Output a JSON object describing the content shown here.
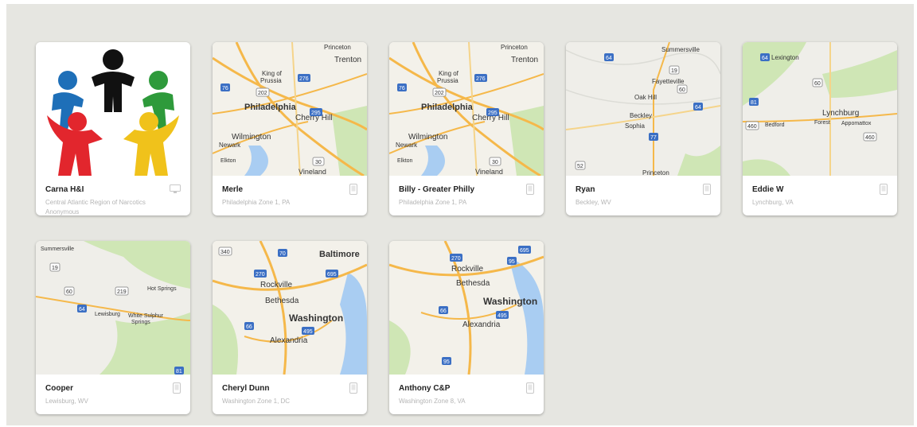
{
  "cards": [
    {
      "name": "Carna H&I",
      "subtitle": "Central Atlantic Region of Narcotics Anonymous",
      "image": "group-logo",
      "device": "monitor-icon"
    },
    {
      "name": "Merle",
      "subtitle": "Philadelphia Zone 1, PA",
      "image": "map-philadelphia",
      "device": "phone-icon",
      "map_labels": [
        "Princeton",
        "Trenton",
        "King of Prussia",
        "Philadelphia",
        "Cherry Hill",
        "Wilmington",
        "Newark",
        "Elkton",
        "Vineland",
        "202",
        "276",
        "1",
        "76",
        "95",
        "295",
        "30"
      ]
    },
    {
      "name": "Billy - Greater Philly",
      "subtitle": "Philadelphia Zone 1, PA",
      "image": "map-philadelphia",
      "device": "phone-icon",
      "map_labels": [
        "Princeton",
        "Trenton",
        "King of Prussia",
        "Philadelphia",
        "Cherry Hill",
        "Wilmington",
        "Newark",
        "Elkton",
        "Vineland",
        "202",
        "276",
        "1",
        "76",
        "95",
        "295",
        "30"
      ]
    },
    {
      "name": "Ryan",
      "subtitle": "Beckley, WV",
      "image": "map-beckley",
      "device": "phone-icon",
      "map_labels": [
        "Summersville",
        "Fayetteville",
        "Oak Hill",
        "Beckley",
        "Sophia",
        "Princeton",
        "64",
        "19",
        "60",
        "64",
        "77",
        "52"
      ]
    },
    {
      "name": "Eddie W",
      "subtitle": "Lynchburg, VA",
      "image": "map-lynchburg",
      "device": "phone-icon",
      "map_labels": [
        "Lexington",
        "Lynchburg",
        "Bedford",
        "Forest",
        "Appomattox",
        "64",
        "60",
        "81",
        "460",
        "460"
      ]
    },
    {
      "name": "Cooper",
      "subtitle": "Lewisburg, WV",
      "image": "map-lewisburg",
      "device": "phone-icon",
      "map_labels": [
        "Summersville",
        "Hot Springs",
        "Lewisburg",
        "White Sulphur Springs",
        "19",
        "60",
        "219",
        "64",
        "81"
      ]
    },
    {
      "name": "Cheryl Dunn",
      "subtitle": "Washington Zone 1, DC",
      "image": "map-washington",
      "device": "phone-icon",
      "map_labels": [
        "Baltimore",
        "Rockville",
        "Bethesda",
        "Washington",
        "Alexandria",
        "340",
        "70",
        "270",
        "95",
        "695",
        "495",
        "66"
      ]
    },
    {
      "name": "Anthony C&P",
      "subtitle": "Washington Zone 8, VA",
      "image": "map-washington",
      "device": "phone-icon",
      "map_labels": [
        "Rockville",
        "Bethesda",
        "Washington",
        "Alexandria",
        "270",
        "695",
        "95",
        "495",
        "66",
        "95"
      ]
    }
  ]
}
